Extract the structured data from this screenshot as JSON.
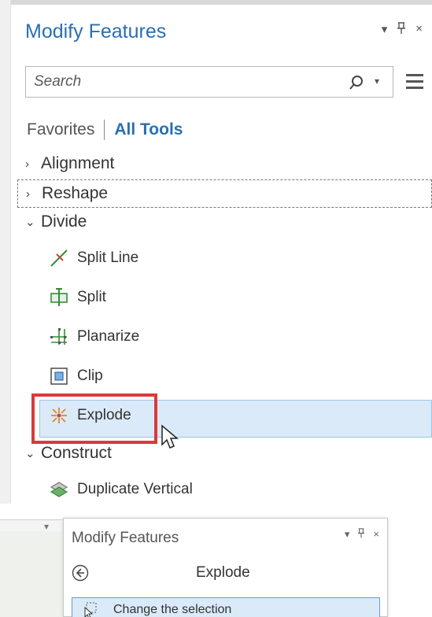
{
  "pane": {
    "title": "Modify Features",
    "controls": {
      "dropdown": "▾",
      "pin": "ᵖ",
      "close": "×"
    }
  },
  "search": {
    "placeholder": "Search",
    "value": ""
  },
  "filters": {
    "favorites": "Favorites",
    "all_tools": "All Tools",
    "active": "All Tools"
  },
  "groups": [
    {
      "label": "Alignment",
      "expanded": false
    },
    {
      "label": "Reshape",
      "expanded": false
    },
    {
      "label": "Divide",
      "expanded": true
    },
    {
      "label": "Construct",
      "expanded": true
    }
  ],
  "divide_tools": [
    {
      "label": "Split Line",
      "icon": "split-line-icon"
    },
    {
      "label": "Split",
      "icon": "split-icon"
    },
    {
      "label": "Planarize",
      "icon": "planarize-icon"
    },
    {
      "label": "Clip",
      "icon": "clip-icon"
    },
    {
      "label": "Explode",
      "icon": "explode-icon",
      "selected": true
    }
  ],
  "construct_tools": [
    {
      "label": "Duplicate Vertical",
      "icon": "duplicate-vertical-icon"
    }
  ],
  "subpane": {
    "title": "Modify Features",
    "heading": "Explode",
    "change_selection": "Change the selection"
  },
  "colors": {
    "accent": "#2a6fb2",
    "selection": "#dbeaf8",
    "highlight_box": "#d93a3a"
  }
}
